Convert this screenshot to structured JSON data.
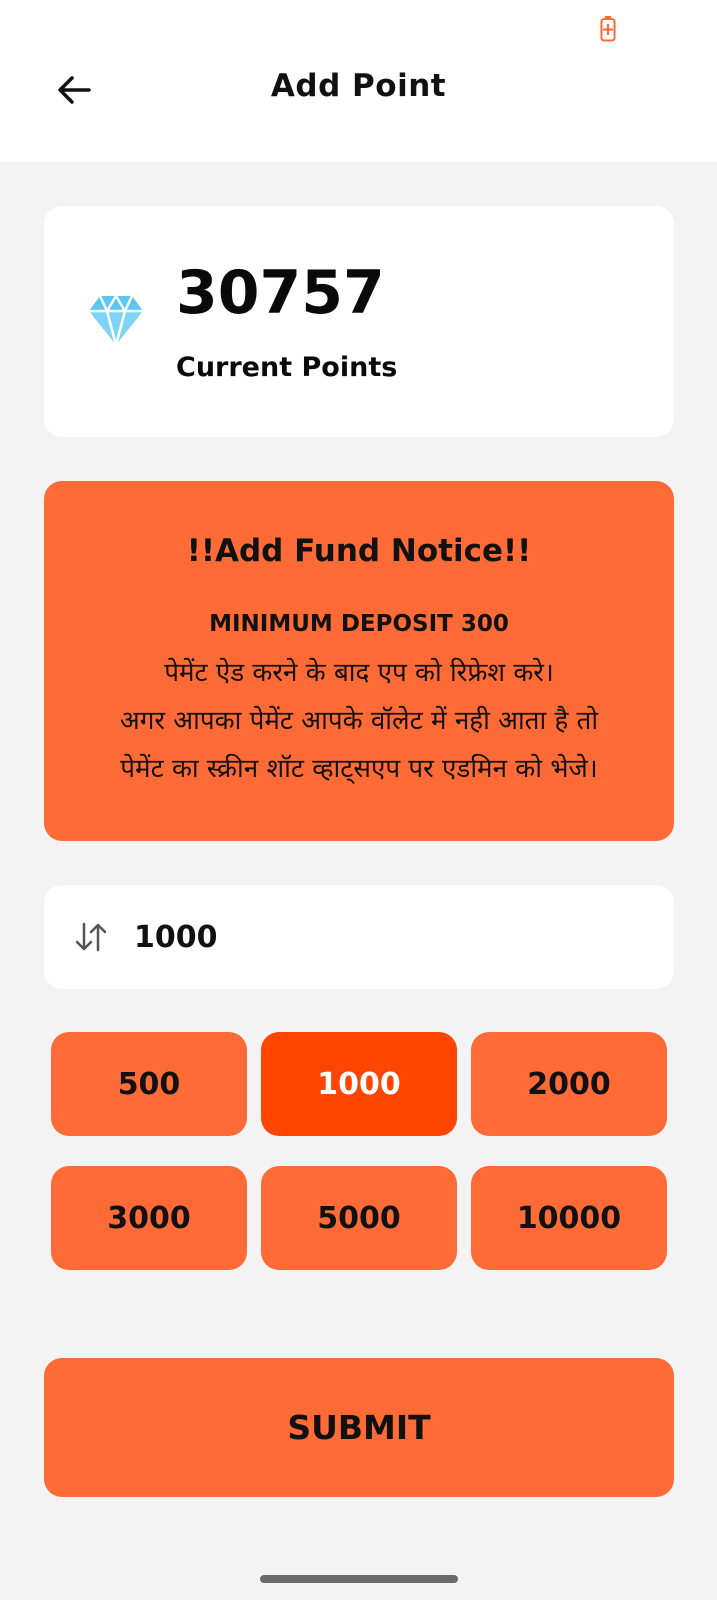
{
  "status_bar": {
    "battery_icon": "battery-charging-icon",
    "battery_color": "#ff6b37"
  },
  "header": {
    "back_icon": "arrow-left-icon",
    "title": "Add Point"
  },
  "points": {
    "value": "30757",
    "label": "Current Points",
    "icon": "diamond-icon"
  },
  "notice": {
    "title": "!!Add Fund Notice!!",
    "minimum": "MINIMUM DEPOSIT 300",
    "lines": [
      "पेमेंट ऐड करने के बाद एप को रिफ्रेश करे।",
      "अगर आपका पेमेंट आपके वॉलेट में नही आता है तो",
      "पेमेंट का स्क्रीन शॉट व्हाट्सएप पर एडमिन को भेजे।"
    ]
  },
  "amount_input": {
    "value": "1000",
    "icon": "sort-arrows-icon"
  },
  "chips": [
    {
      "label": "500",
      "selected": false
    },
    {
      "label": "1000",
      "selected": true
    },
    {
      "label": "2000",
      "selected": false
    },
    {
      "label": "3000",
      "selected": false
    },
    {
      "label": "5000",
      "selected": false
    },
    {
      "label": "10000",
      "selected": false
    }
  ],
  "submit_label": "SUBMIT",
  "colors": {
    "accent": "#ff6b37",
    "selected": "#ff4500",
    "background": "#f3f3f3",
    "card": "#ffffff"
  }
}
